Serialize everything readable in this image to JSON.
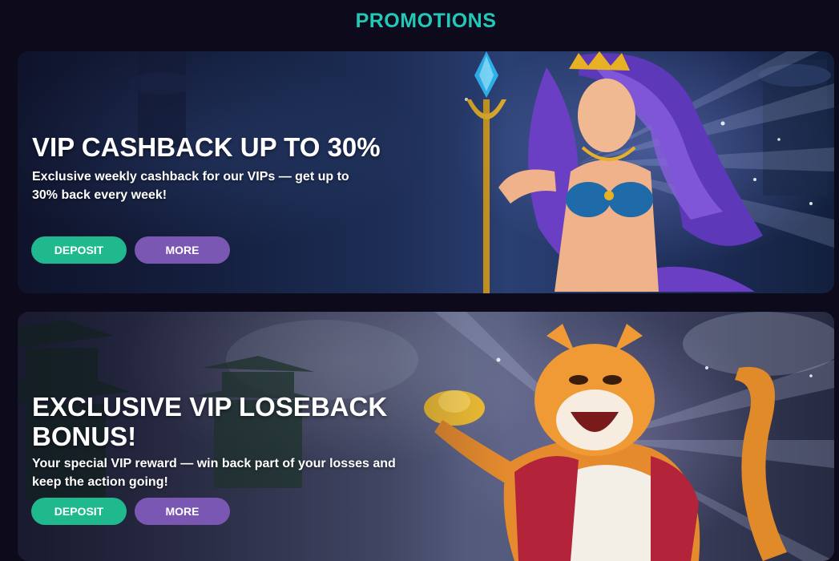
{
  "page": {
    "title": "PROMOTIONS"
  },
  "promotions": [
    {
      "title": "VIP CASHBACK UP TO 30%",
      "description": "Exclusive weekly cashback for our VIPs — get up to 30% back every week!",
      "deposit_label": "DEPOSIT",
      "more_label": "MORE",
      "art": "sea-goddess-with-trident"
    },
    {
      "title": "EXCLUSIVE VIP LOSEBACK BONUS!",
      "description": "Your special VIP reward — win back part of your losses and keep the action going!",
      "deposit_label": "DEPOSIT",
      "more_label": "MORE",
      "art": "laughing-tiger-with-gold-ingot"
    }
  ],
  "colors": {
    "title_accent": "#22c9b8",
    "deposit_button": "#20b98e",
    "more_button": "#7b57b4",
    "background": "#0d0a1c"
  }
}
